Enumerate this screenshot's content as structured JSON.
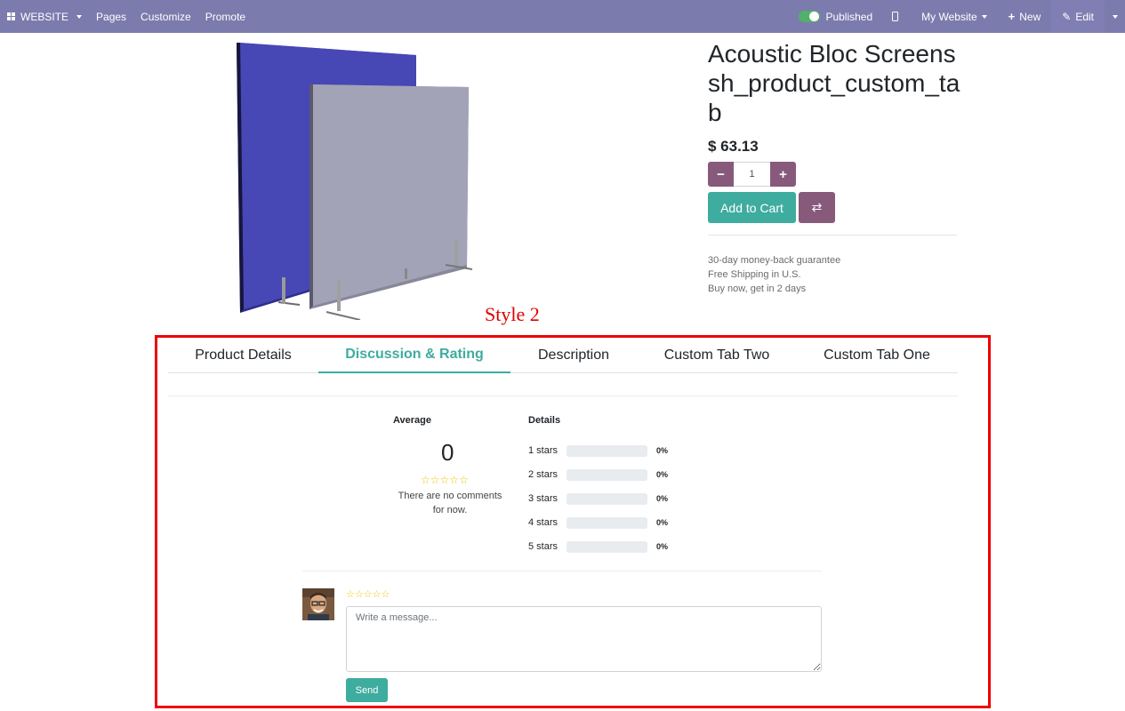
{
  "topbar": {
    "brand": "WEBSITE",
    "menu": [
      "Pages",
      "Customize",
      "Promote"
    ],
    "published_label": "Published",
    "website_label": "My Website",
    "new_label": "New",
    "edit_label": "Edit"
  },
  "product": {
    "name": "Acoustic Bloc Screenssh_product_custom_tab",
    "price": "$ 63.13",
    "quantity": "1",
    "add_to_cart": "Add to Cart",
    "info": [
      "30-day money-back guarantee",
      "Free Shipping in U.S.",
      "Buy now, get in 2 days"
    ]
  },
  "annotation": {
    "label": "Style 2",
    "color": "#ee0000"
  },
  "tabs": [
    {
      "label": "Product Details",
      "active": false
    },
    {
      "label": "Discussion & Rating",
      "active": true
    },
    {
      "label": "Description",
      "active": false
    },
    {
      "label": "Custom Tab Two",
      "active": false
    },
    {
      "label": "Custom Tab One",
      "active": false
    }
  ],
  "rating": {
    "average_label": "Average",
    "average_value": "0",
    "stars": "☆☆☆☆☆",
    "no_comments": "There are no comments for now.",
    "details_label": "Details",
    "breakdown": [
      {
        "label": "1 stars",
        "pct": "0%"
      },
      {
        "label": "2 stars",
        "pct": "0%"
      },
      {
        "label": "3 stars",
        "pct": "0%"
      },
      {
        "label": "4 stars",
        "pct": "0%"
      },
      {
        "label": "5 stars",
        "pct": "0%"
      }
    ]
  },
  "comment": {
    "stars": "☆☆☆☆☆",
    "placeholder": "Write a message...",
    "send_label": "Send"
  },
  "colors": {
    "topbar": "#7c7bad",
    "accent": "#3eac9f",
    "secondary": "#875a7b"
  }
}
